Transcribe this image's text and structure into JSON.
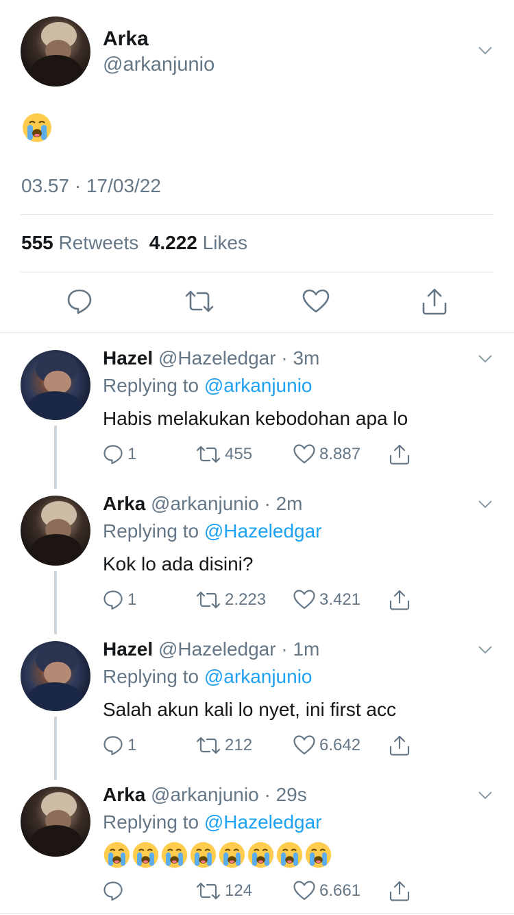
{
  "main_tweet": {
    "name": "Arka",
    "handle": "@arkanjunio",
    "emoji": "loudly-crying-face",
    "time": "03.57 · 17/03/22",
    "retweets_count": "555",
    "retweets_label": "Retweets",
    "likes_count": "4.222",
    "likes_label": "Likes"
  },
  "replies": [
    {
      "name": "Hazel",
      "handle": "@Hazeledgar",
      "time": "3m",
      "replying_prefix": "Replying to",
      "replying_to": "@arkanjunio",
      "text": "Habis melakukan kebodohan apa lo",
      "reply_count": "1",
      "retweet_count": "455",
      "like_count": "8.887"
    },
    {
      "name": "Arka",
      "handle": "@arkanjunio",
      "time": "2m",
      "replying_prefix": "Replying to",
      "replying_to": "@Hazeledgar",
      "text": "Kok lo ada disini?",
      "reply_count": "1",
      "retweet_count": "2.223",
      "like_count": "3.421"
    },
    {
      "name": "Hazel",
      "handle": "@Hazeledgar",
      "time": "1m",
      "replying_prefix": "Replying to",
      "replying_to": "@arkanjunio",
      "text": "Salah akun kali lo nyet, ini first acc",
      "reply_count": "1",
      "retweet_count": "212",
      "like_count": "6.642"
    },
    {
      "name": "Arka",
      "handle": "@arkanjunio",
      "time": "29s",
      "replying_prefix": "Replying to",
      "replying_to": "@Hazeledgar",
      "text_emoji_count": 8,
      "reply_count": "",
      "retweet_count": "124",
      "like_count": "6.661"
    }
  ],
  "colors": {
    "text": "#14171a",
    "secondary": "#657786",
    "link": "#1da1f2",
    "divider": "#e1e8ed",
    "thread_line": "#ccd6dd"
  }
}
